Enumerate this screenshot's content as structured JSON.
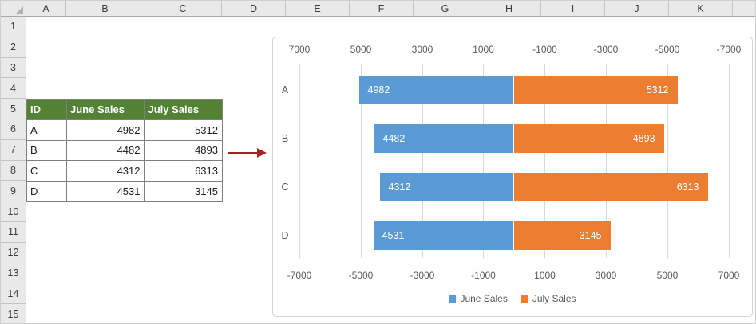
{
  "sheet": {
    "column_headers": [
      "A",
      "B",
      "C",
      "D",
      "E",
      "F",
      "G",
      "H",
      "I",
      "J",
      "K"
    ],
    "row_headers": [
      "1",
      "2",
      "3",
      "4",
      "5",
      "6",
      "7",
      "8",
      "9",
      "10",
      "11",
      "12",
      "13",
      "14",
      "15"
    ]
  },
  "table": {
    "headers": [
      "ID",
      "June Sales",
      "July Sales"
    ],
    "rows": [
      {
        "id": "A",
        "june": "4982",
        "july": "5312"
      },
      {
        "id": "B",
        "june": "4482",
        "july": "4893"
      },
      {
        "id": "C",
        "june": "4312",
        "july": "6313"
      },
      {
        "id": "D",
        "june": "4531",
        "july": "3145"
      }
    ]
  },
  "chart_data": {
    "type": "bar",
    "subtype": "tornado-horizontal",
    "categories": [
      "A",
      "B",
      "C",
      "D"
    ],
    "series": [
      {
        "name": "June Sales",
        "color": "#5B9BD5",
        "side": "left",
        "values": [
          4982,
          4482,
          4312,
          4531
        ]
      },
      {
        "name": "July Sales",
        "color": "#ED7D31",
        "side": "right",
        "values": [
          5312,
          4893,
          6313,
          3145
        ]
      }
    ],
    "top_axis_ticks": [
      "7000",
      "5000",
      "3000",
      "1000",
      "-1000",
      "-3000",
      "-5000",
      "-7000"
    ],
    "bottom_axis_ticks": [
      "-7000",
      "-5000",
      "-3000",
      "-1000",
      "1000",
      "3000",
      "5000",
      "7000"
    ],
    "axis_range": [
      -7000,
      7000
    ],
    "grid": true,
    "legend_position": "bottom",
    "data_label_position": "inside-end",
    "data_label_color": "#FFFFFF"
  },
  "colors": {
    "table_header_bg": "#548235",
    "table_header_text": "#FFFFFF",
    "arrow": "#A32323",
    "axis_text": "#595959",
    "gridline": "#D9D9D9",
    "sheet_header_bg": "#E9E9E9"
  }
}
